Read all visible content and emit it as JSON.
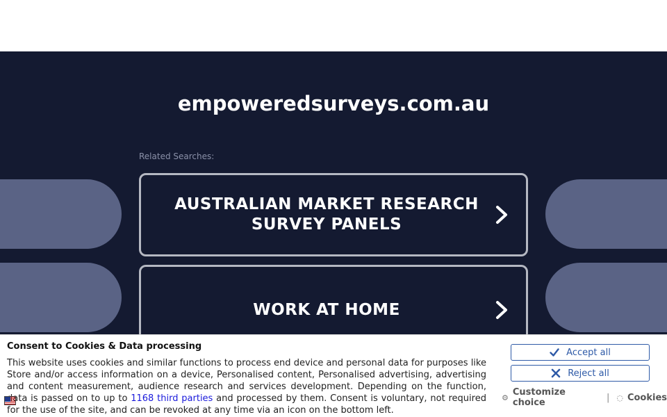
{
  "page": {
    "domain": "empoweredsurveys.com.au",
    "related_label": "Related Searches:",
    "searches": [
      {
        "label": "AUSTRALIAN MARKET RESEARCH SURVEY PANELS"
      },
      {
        "label": "WORK AT HOME"
      }
    ]
  },
  "consent": {
    "title": "Consent to Cookies & Data processing",
    "body_before_link": "This website uses cookies and similar functions to process end device and personal data for purposes like Store and/or access information on a device, Personalised content, Personalised advertising, advertising and content measurement, audience research and services development. Depending on the function, data is passed on to up to ",
    "link_text": "1168 third parties",
    "body_after_link": " and processed by them. Consent is voluntary, not required for the use of the site, and can be revoked at any time via an icon on the bottom left.",
    "accept_label": "Accept all",
    "reject_label": "Reject all",
    "customize_label": "Customize choice",
    "separator": "|",
    "cookies_label": "Cookies"
  },
  "colors": {
    "background": "#141a31",
    "pill": "#5a6385",
    "card_border": "#b5b8c2",
    "button_accent": "#2e5aa7",
    "link": "#1a1adb"
  },
  "icons": {
    "card_arrow": "chevron-right-icon",
    "accept": "checkmark-icon",
    "reject": "close-icon",
    "customize": "gear-icon",
    "cookies": "cookie-icon",
    "language": "flag-icon"
  }
}
